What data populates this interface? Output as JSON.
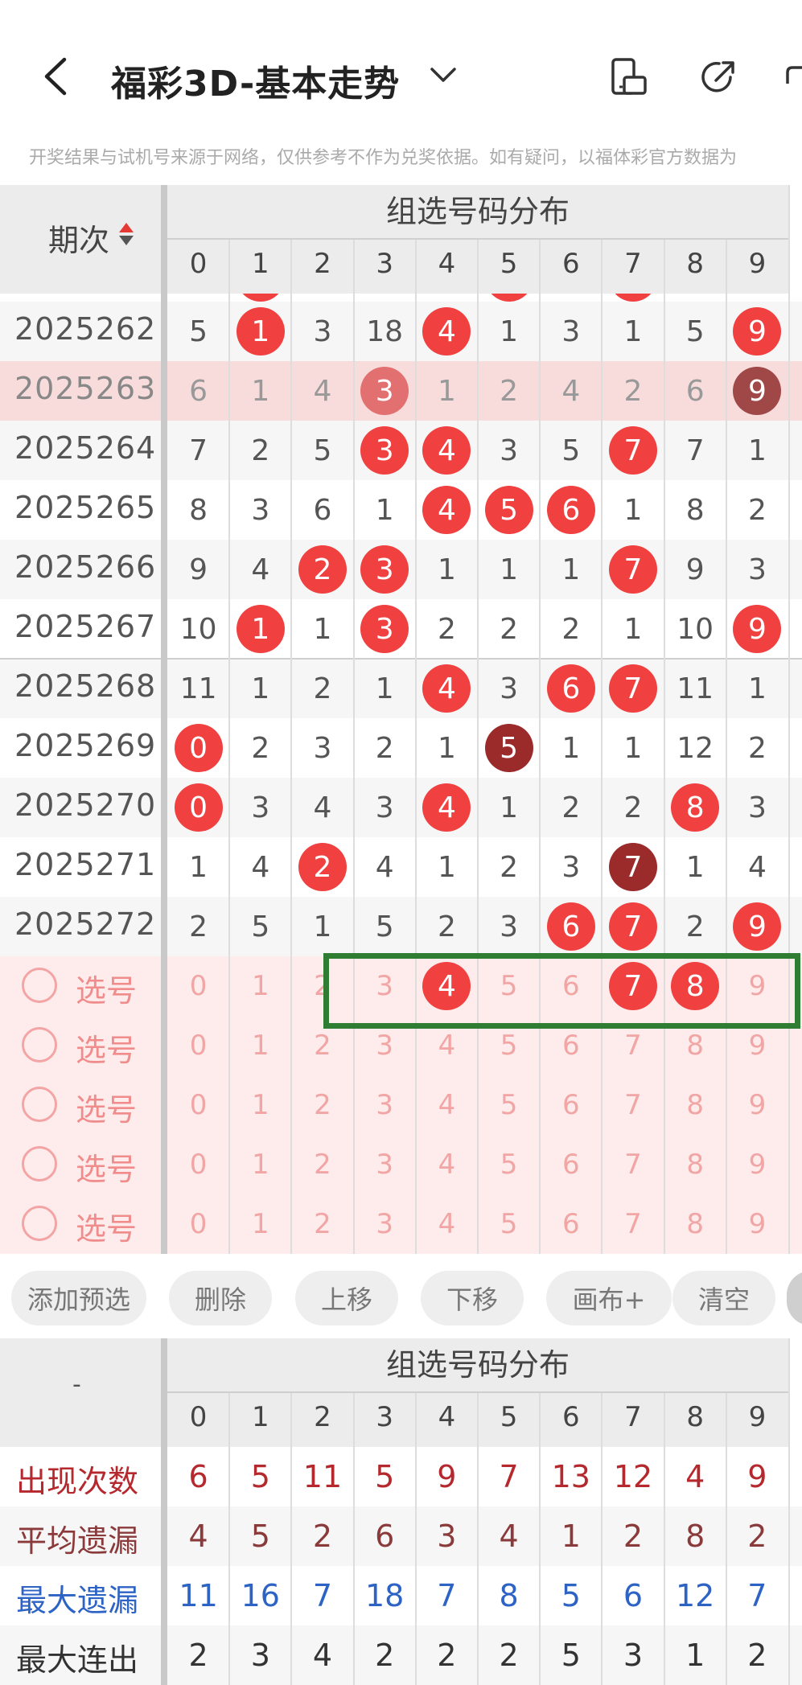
{
  "header": {
    "title": "福彩3D-基本走势",
    "disclaimer": "开奖结果与试机号来源于网络，仅供参考不作为兑奖依据。如有疑问，以福体彩官方数据为"
  },
  "table": {
    "period_header": "期次",
    "group_title": "组选号码分布",
    "digits": [
      "0",
      "1",
      "2",
      "3",
      "4",
      "5",
      "6",
      "7",
      "8",
      "9"
    ],
    "rows": [
      {
        "period": "2025262",
        "cells": [
          "5",
          "1",
          "3",
          "18",
          "4",
          "1",
          "3",
          "1",
          "5",
          "9"
        ],
        "hits": [
          1,
          4,
          9
        ],
        "dark": []
      },
      {
        "period": "2025263",
        "cells": [
          "6",
          "1",
          "4",
          "3",
          "1",
          "2",
          "4",
          "2",
          "6",
          "9"
        ],
        "hits": [
          3,
          9
        ],
        "dark": [
          9
        ],
        "highlight": true
      },
      {
        "period": "2025264",
        "cells": [
          "7",
          "2",
          "5",
          "3",
          "4",
          "3",
          "5",
          "7",
          "7",
          "1"
        ],
        "hits": [
          3,
          4,
          7
        ],
        "dark": []
      },
      {
        "period": "2025265",
        "cells": [
          "8",
          "3",
          "6",
          "1",
          "4",
          "5",
          "6",
          "1",
          "8",
          "2"
        ],
        "hits": [
          4,
          5,
          6
        ],
        "dark": []
      },
      {
        "period": "2025266",
        "cells": [
          "9",
          "4",
          "2",
          "3",
          "1",
          "1",
          "1",
          "7",
          "9",
          "3"
        ],
        "hits": [
          2,
          3,
          7
        ],
        "dark": []
      },
      {
        "period": "2025267",
        "cells": [
          "10",
          "1",
          "1",
          "3",
          "2",
          "2",
          "2",
          "1",
          "10",
          "9"
        ],
        "hits": [
          1,
          3,
          9
        ],
        "dark": []
      },
      {
        "period": "2025268",
        "cells": [
          "11",
          "1",
          "2",
          "1",
          "4",
          "3",
          "6",
          "7",
          "11",
          "1"
        ],
        "hits": [
          4,
          6,
          7
        ],
        "dark": []
      },
      {
        "period": "2025269",
        "cells": [
          "0",
          "2",
          "3",
          "2",
          "1",
          "5",
          "1",
          "1",
          "12",
          "2"
        ],
        "hits": [
          0,
          5
        ],
        "dark": [
          5
        ]
      },
      {
        "period": "2025270",
        "cells": [
          "0",
          "3",
          "4",
          "3",
          "4",
          "1",
          "2",
          "2",
          "8",
          "3"
        ],
        "hits": [
          0,
          4,
          8
        ],
        "dark": []
      },
      {
        "period": "2025271",
        "cells": [
          "1",
          "4",
          "2",
          "4",
          "1",
          "2",
          "3",
          "7",
          "1",
          "4"
        ],
        "hits": [
          2,
          7
        ],
        "dark": [
          7
        ]
      },
      {
        "period": "2025272",
        "cells": [
          "2",
          "5",
          "1",
          "5",
          "2",
          "3",
          "6",
          "7",
          "2",
          "9"
        ],
        "hits": [
          6,
          7,
          9
        ],
        "dark": []
      }
    ],
    "select_label": "选号",
    "select_rows": [
      {
        "picked": [
          4,
          7,
          8
        ]
      },
      {
        "picked": []
      },
      {
        "picked": []
      },
      {
        "picked": []
      },
      {
        "picked": []
      }
    ]
  },
  "buttons": [
    "添加预选",
    "删除",
    "上移",
    "下移",
    "画布+",
    "清空"
  ],
  "stats": {
    "corner": "-",
    "group_title": "组选号码分布",
    "rows": [
      {
        "label": "出现次数",
        "color": "#b5282d",
        "values": [
          "6",
          "5",
          "11",
          "5",
          "9",
          "7",
          "13",
          "12",
          "4",
          "9"
        ]
      },
      {
        "label": "平均遗漏",
        "color": "#8a3a3a",
        "values": [
          "4",
          "5",
          "2",
          "6",
          "3",
          "4",
          "1",
          "2",
          "8",
          "2"
        ]
      },
      {
        "label": "最大遗漏",
        "color": "#2c63c4",
        "values": [
          "11",
          "16",
          "7",
          "18",
          "7",
          "8",
          "5",
          "6",
          "12",
          "7"
        ]
      },
      {
        "label": "最大连出",
        "color": "#333333",
        "values": [
          "2",
          "3",
          "4",
          "2",
          "2",
          "2",
          "5",
          "3",
          "1",
          "2"
        ]
      }
    ]
  }
}
